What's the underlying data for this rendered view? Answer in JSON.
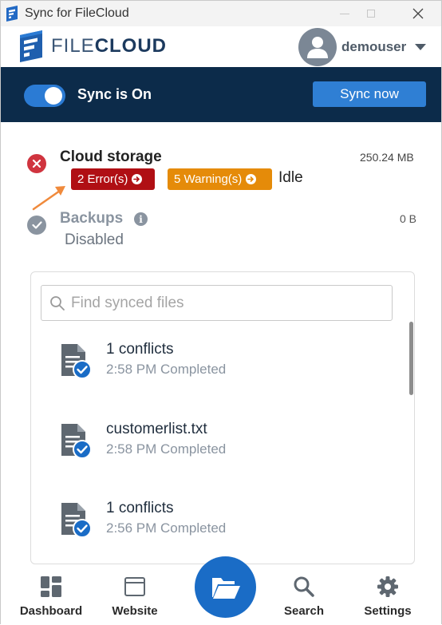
{
  "window": {
    "title": "Sync for FileCloud"
  },
  "header": {
    "logo_light": "FILE",
    "logo_bold": "CLOUD",
    "username": "demouser"
  },
  "sync": {
    "enabled": true,
    "status_text": "Sync is On",
    "sync_now_label": "Sync now"
  },
  "storage": {
    "cloud": {
      "title": "Cloud storage",
      "size": "250.24 MB",
      "status": "error",
      "errors_label": "2 Error(s)",
      "warnings_label": "5 Warning(s)",
      "state": "Idle"
    },
    "backups": {
      "title": "Backups",
      "size": "0 B",
      "state": "Disabled"
    }
  },
  "files": {
    "search_placeholder": "Find synced files",
    "items": [
      {
        "name": "1 conflicts",
        "meta": "2:58 PM Completed"
      },
      {
        "name": "customerlist.txt",
        "meta": "2:58 PM Completed"
      },
      {
        "name": "1 conflicts",
        "meta": "2:56 PM Completed"
      }
    ]
  },
  "nav": {
    "dashboard": "Dashboard",
    "website": "Website",
    "search": "Search",
    "settings": "Settings",
    "center_icon": "folder-open-icon"
  },
  "colors": {
    "header_bg": "#0c2b4a",
    "accent": "#2f7fd4",
    "error": "#b00f14",
    "warning": "#e58b09",
    "fab": "#1a6cc6"
  }
}
